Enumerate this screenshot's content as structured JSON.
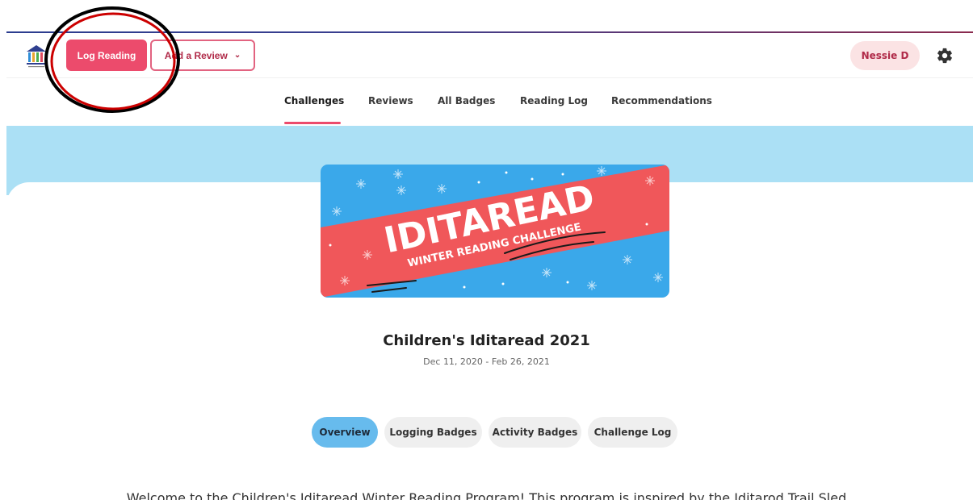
{
  "header": {
    "log_reading_label": "Log Reading",
    "add_review_label": "Add a Review",
    "user_name": "Nessie D",
    "icons": {
      "logo": "library-logo-icon",
      "dropdown": "chevron-down-icon",
      "settings": "gear-icon"
    }
  },
  "nav": {
    "tabs": [
      {
        "label": "Challenges",
        "active": true
      },
      {
        "label": "Reviews",
        "active": false
      },
      {
        "label": "All Badges",
        "active": false
      },
      {
        "label": "Reading Log",
        "active": false
      },
      {
        "label": "Recommendations",
        "active": false
      }
    ]
  },
  "banner": {
    "title_text": "IDITAREAD",
    "subtitle_text": "WINTER READING CHALLENGE"
  },
  "challenge": {
    "title": "Children's Iditaread 2021",
    "dates": "Dec 11, 2020 - Feb 26, 2021"
  },
  "subtabs": [
    {
      "label": "Overview",
      "active": true
    },
    {
      "label": "Logging Badges",
      "active": false
    },
    {
      "label": "Activity Badges",
      "active": false
    },
    {
      "label": "Challenge Log",
      "active": false
    }
  ],
  "intro_text": "Welcome to the Children's Iditaread Winter Reading Program! This program is inspired by the Iditarod Trail Sled",
  "colors": {
    "accent": "#ec4b6c",
    "user_pill_bg": "#fbe3e4",
    "band": "#abe0f5",
    "active_subtab": "#67bbed",
    "banner_blue": "#3aa8ea",
    "banner_red": "#f0575a",
    "annotation": "#000000"
  }
}
